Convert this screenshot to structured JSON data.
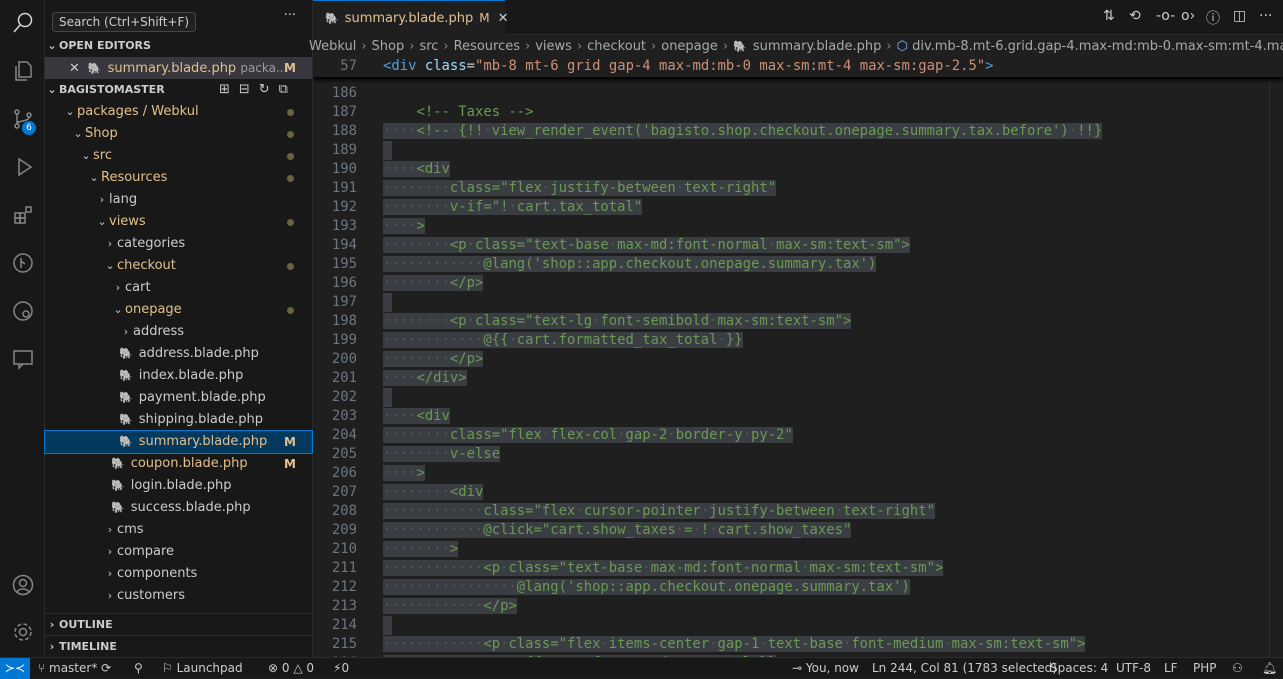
{
  "activity": {
    "scm_badge": "6",
    "items": [
      "search-icon",
      "files-icon",
      "source-control-icon",
      "run-debug-icon",
      "extensions-icon",
      "git-graph-icon",
      "remote-explorer-icon",
      "chat-icon"
    ],
    "bottom": [
      "account-icon",
      "gear-icon"
    ]
  },
  "tooltip": "Search (Ctrl+Shift+F)",
  "sidebar": {
    "more": "···",
    "open_editors": "OPEN EDITORS",
    "open_file": {
      "name": "summary.blade.php",
      "path": "packa...",
      "status": "M"
    },
    "root": "BAGISTOMASTER",
    "tree": [
      {
        "label": "packages / Webkul",
        "depth": 1,
        "type": "folder-open",
        "dot": true
      },
      {
        "label": "Shop",
        "depth": 2,
        "type": "folder-open",
        "dot": true
      },
      {
        "label": "src",
        "depth": 3,
        "type": "folder-open",
        "dot": true
      },
      {
        "label": "Resources",
        "depth": 4,
        "type": "folder-open",
        "dot": true
      },
      {
        "label": "lang",
        "depth": 5,
        "type": "folder"
      },
      {
        "label": "views",
        "depth": 5,
        "type": "folder-open",
        "dot": true
      },
      {
        "label": "categories",
        "depth": 6,
        "type": "folder"
      },
      {
        "label": "checkout",
        "depth": 6,
        "type": "folder-open",
        "dot": true
      },
      {
        "label": "cart",
        "depth": 7,
        "type": "folder"
      },
      {
        "label": "onepage",
        "depth": 7,
        "type": "folder-open",
        "dot": true
      },
      {
        "label": "address",
        "depth": 8,
        "type": "folder"
      },
      {
        "label": "address.blade.php",
        "depth": 8,
        "type": "file"
      },
      {
        "label": "index.blade.php",
        "depth": 8,
        "type": "file"
      },
      {
        "label": "payment.blade.php",
        "depth": 8,
        "type": "file"
      },
      {
        "label": "shipping.blade.php",
        "depth": 8,
        "type": "file"
      },
      {
        "label": "summary.blade.php",
        "depth": 8,
        "type": "file",
        "status": "M",
        "selected": true
      },
      {
        "label": "coupon.blade.php",
        "depth": 7,
        "type": "file",
        "status": "M"
      },
      {
        "label": "login.blade.php",
        "depth": 7,
        "type": "file"
      },
      {
        "label": "success.blade.php",
        "depth": 7,
        "type": "file"
      },
      {
        "label": "cms",
        "depth": 6,
        "type": "folder"
      },
      {
        "label": "compare",
        "depth": 6,
        "type": "folder"
      },
      {
        "label": "components",
        "depth": 6,
        "type": "folder"
      },
      {
        "label": "customers",
        "depth": 6,
        "type": "folder"
      }
    ],
    "outline": "OUTLINE",
    "timeline": "TIMELINE"
  },
  "tab": {
    "name": "summary.blade.php",
    "status": "M",
    "close": "✕"
  },
  "breadcrumbs": [
    "Webkul",
    "Shop",
    "src",
    "Resources",
    "views",
    "checkout",
    "onepage",
    "summary.blade.php",
    "div.mb-8.mt-6.grid.gap-4.max-md:mb-0.max-sm:mt-4.max-sm:gap-2.5"
  ],
  "sticky": {
    "line": "57",
    "tag": "<div",
    "attr": "class",
    "eq": "=",
    "value": "\"mb-8 mt-6 grid gap-4 max-md:mb-0 max-sm:mt-4 max-sm:gap-2.5\"",
    "close": ">"
  },
  "code": {
    "first_line": 186,
    "selection_from": 188,
    "lines": [
      "",
      "    <!-- Taxes -->",
      "    <!-- {!! view_render_event('bagisto.shop.checkout.onepage.summary.tax.before') !!}",
      "",
      "    <div",
      "        class=\"flex justify-between text-right\"",
      "        v-if=\"! cart.tax_total\"",
      "    >",
      "        <p class=\"text-base max-md:font-normal max-sm:text-sm\">",
      "            @lang('shop::app.checkout.onepage.summary.tax')",
      "        </p>",
      "",
      "        <p class=\"text-lg font-semibold max-sm:text-sm\">",
      "            @{{ cart.formatted_tax_total }}",
      "        </p>",
      "    </div>",
      "",
      "    <div",
      "        class=\"flex flex-col gap-2 border-y py-2\"",
      "        v-else",
      "    >",
      "        <div",
      "            class=\"flex cursor-pointer justify-between text-right\"",
      "            @click=\"cart.show_taxes = ! cart.show_taxes\"",
      "        >",
      "            <p class=\"text-base max-md:font-normal max-sm:text-sm\">",
      "                @lang('shop::app.checkout.onepage.summary.tax')",
      "            </p>",
      "",
      "            <p class=\"flex items-center gap-1 text-base font-medium max-sm:text-sm\">",
      "                @{{ cart.formatted_tax_total }}"
    ]
  },
  "status": {
    "remote": "≻≺",
    "branch": "master*",
    "launchpad": "Launchpad",
    "errors": "0",
    "warnings": "0",
    "ports": "0",
    "blame": "You, now",
    "position": "Ln 244, Col 81 (1783 selected)",
    "spaces": "Spaces: 4",
    "encoding": "UTF-8",
    "eol": "LF",
    "language": "PHP"
  },
  "colors": {
    "accent": "#0078d4",
    "modified": "#e2c08d",
    "comment": "#6a9955",
    "selection": "#3a3d41"
  }
}
